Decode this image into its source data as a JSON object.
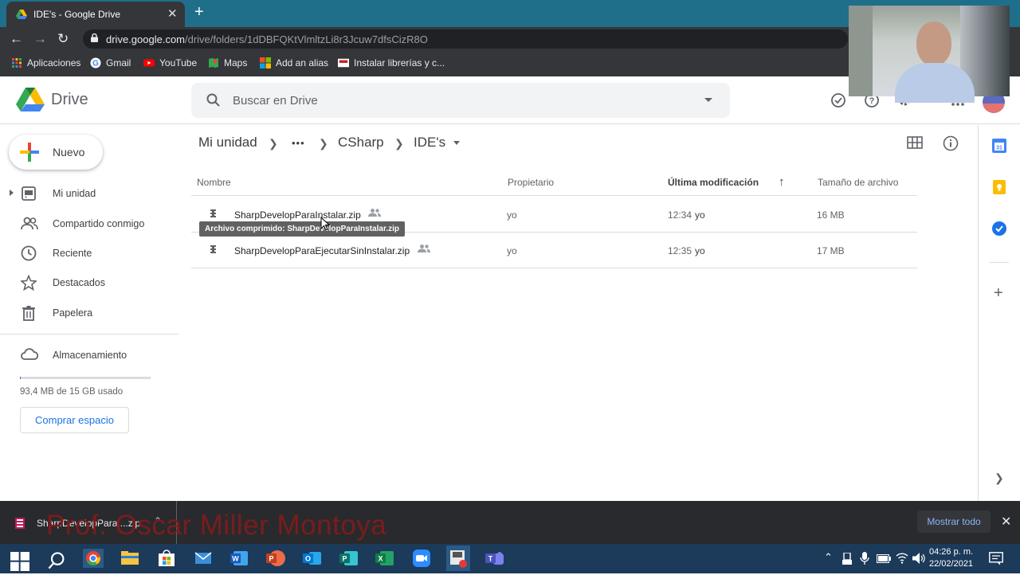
{
  "browser": {
    "tab_title": "IDE's - Google Drive",
    "url_host": "drive.google.com",
    "url_path": "/drive/folders/1dDBFQKtVlmltzLi8r3Jcuw7dfsCizR8O",
    "bookmarks": [
      "Aplicaciones",
      "Gmail",
      "YouTube",
      "Maps",
      "Add an alias",
      "Instalar librerías y c..."
    ]
  },
  "drive": {
    "product": "Drive",
    "search_placeholder": "Buscar en Drive",
    "new_label": "Nuevo",
    "nav": [
      "Mi unidad",
      "Compartido conmigo",
      "Reciente",
      "Destacados",
      "Papelera"
    ],
    "storage_label": "Almacenamiento",
    "storage_used_fraction": 0.006,
    "storage_text": "93,4 MB de 15 GB usado",
    "buy_label": "Comprar espacio"
  },
  "breadcrumb": {
    "root": "Mi unidad",
    "more": "•••",
    "parent": "CSharp",
    "current": "IDE's"
  },
  "table": {
    "columns": {
      "name": "Nombre",
      "owner": "Propietario",
      "modified": "Última modificación",
      "size": "Tamaño de archivo"
    },
    "rows": [
      {
        "name": "SharpDevelopParaInstalar.zip",
        "owner": "yo",
        "modified_time": "12:34",
        "modified_by": "yo",
        "size": "16 MB"
      },
      {
        "name": "SharpDevelopParaEjecutarSinInstalar.zip",
        "owner": "yo",
        "modified_time": "12:35",
        "modified_by": "yo",
        "size": "17 MB"
      }
    ]
  },
  "tooltip": "Archivo comprimido: SharpDevelopParaInstalar.zip",
  "download": {
    "file": "SharpDevelopPara....zip",
    "show_all": "Mostrar todo"
  },
  "watermark": "Prof. Oscar Miller Montoya",
  "clock": {
    "time": "04:26 p. m.",
    "date": "22/02/2021"
  },
  "colors": {
    "accent": "#1a73e8",
    "taskbar": "#1c3a5a",
    "chrome_dark": "#35363a"
  }
}
